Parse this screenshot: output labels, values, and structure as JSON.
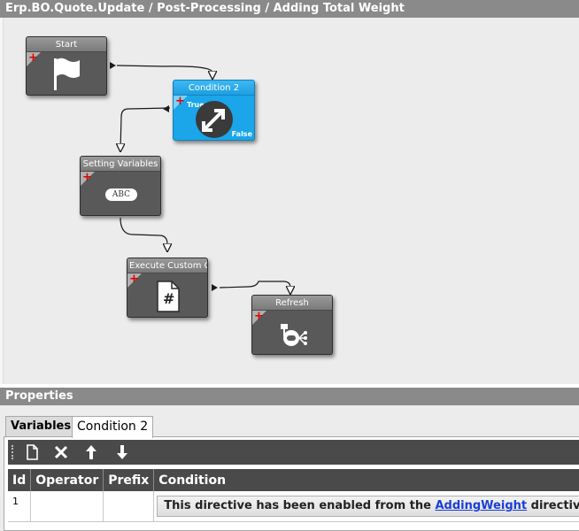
{
  "title": "Erp.BO.Quote.Update / Post-Processing / Adding Total Weight",
  "nodes": {
    "start": {
      "label": "Start"
    },
    "condition": {
      "label": "Condition 2",
      "true_label": "True",
      "false_label": "False"
    },
    "setting_variables": {
      "label": "Setting Variables",
      "icon_text": "ABC"
    },
    "execute_custom_code": {
      "label": "Execute Custom Code",
      "icon_text": "#"
    },
    "refresh": {
      "label": "Refresh"
    }
  },
  "properties": {
    "header": "Properties",
    "tabs": [
      {
        "label": "Variables",
        "active": false
      },
      {
        "label": "Condition 2",
        "active": true
      }
    ],
    "toolbar": [
      "new-icon",
      "delete-icon",
      "move-up-icon",
      "move-down-icon"
    ],
    "table": {
      "columns": [
        "Id",
        "Operator",
        "Prefix",
        "Condition"
      ],
      "rows": [
        {
          "id": "1",
          "operator": "",
          "prefix": "",
          "condition_pre": "This directive has been enabled from the ",
          "condition_link": "AddingWeight",
          "condition_post": " directive"
        }
      ]
    }
  },
  "colors": {
    "selected_node": "#1aa6e8",
    "node_body": "#595959",
    "header_bar": "#8a8a8a",
    "plus_marker": "#e00000",
    "link": "#1a3fd6"
  }
}
